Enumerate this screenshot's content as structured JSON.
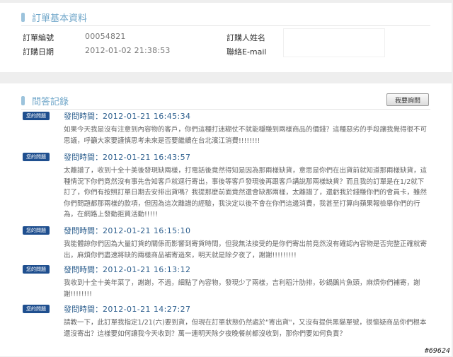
{
  "order_section": {
    "title": "訂單基本資料",
    "order_no_label": "訂單編號",
    "order_no": "00054821",
    "order_date_label": "訂購日期",
    "order_date": "2012-01-02 21:38:53",
    "buyer_name_label": "訂購人姓名",
    "email_label": "聯絡E-mail"
  },
  "qa_section": {
    "title": "問答記錄",
    "ask_button": "我要詢問",
    "items": [
      {
        "badge": "您的問題",
        "time_label": "發問時間：",
        "time": "2012-01-21 16:45:34",
        "text": "如果今天我是沒有注意到內容物的客戶，你們這種打迷糊仗不就能穩賺到兩樣商品的價錢？這種惡劣的手段讓我覺得很不可思議，呼籲大家要謹慎思考未來是否要繼續在台北濱江消費!!!!!!!!"
      },
      {
        "badge": "您的問題",
        "time_label": "發問時間：",
        "time": "2012-01-21 16:43:57",
        "text": "太離譜了，收到十全十美後發現缺兩樣，打電話後竟然得知是因為那兩樣缺貨，意思是你們在出貨前就知道那兩樣缺貨，這種情況下你們竟然沒有事先告知客戶就逕行寄出，事後等客戶發現後再跟客戶講說那兩樣缺貨？而且我的訂單是在1/2就下訂了，你們有按照訂單日期去安排出貨嗎？我提那麼前面竟然還會缺那兩樣，太離譜了，還虧我於錢賺你們的會員卡，雖然你們問題都那兩樣的款項，但因為這次離譜的經驗，我決定以後不會在你們這邊消費，我甚至打算向蘋果報檢舉你們的行為，在網路上發動拒買活動!!!!!"
      },
      {
        "badge": "您的問題",
        "time_label": "發問時間：",
        "time": "2012-01-21 16:15:10",
        "text": "我能體諒你們因為大量訂貨的關係而影響到寄貨時間，但我無法接受的是你們寄出前竟然沒有確認內容物是否完整正確就寄出，麻煩你們盡速將缺的兩樣商品補寄過來，明天就是除夕夜了，謝謝!!!!!!!!!"
      },
      {
        "badge": "您的問題",
        "time_label": "發問時間：",
        "time": "2012-01-21 16:13:12",
        "text": "我收到十全十美年菜了，謝謝，不過，細點了內容物，發現少了兩樣，吉利稻汁肋排，砂鍋鵝片魚頭，麻煩你們補寄，謝謝!!!!!!!!"
      },
      {
        "badge": "您的問題",
        "time_label": "發問時間：",
        "time": "2012-01-21 14:27:27",
        "text": "請教一下，此訂單我指定1/21(六)要到貨，但現在訂單狀態仍然處於\"寄出貨\"，又沒有提供黑貓單號，很懷疑商品你們根本還沒寄出？這樣要如何讓我今天收到？萬一連明天除夕夜晚餐前都沒收到，那你們要如何負責？"
      }
    ]
  },
  "watermark": "#69624"
}
